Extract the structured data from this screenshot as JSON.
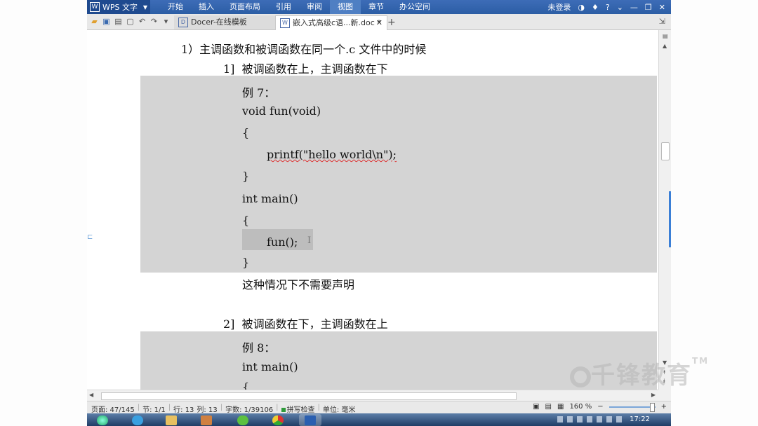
{
  "titlebar": {
    "app_name": "WPS 文字",
    "menu": [
      "开始",
      "插入",
      "页面布局",
      "引用",
      "审阅",
      "视图",
      "章节",
      "办公空间"
    ],
    "active_menu": "视图",
    "login": "未登录",
    "help": "?"
  },
  "tabs": [
    {
      "label": "Docer-在线模板"
    },
    {
      "label": "嵌入式高级c语...新.doc *"
    }
  ],
  "document": {
    "heading1": "1）主调函数和被调函数在同一个.c 文件中的时候",
    "sub1": "1]  被调函数在上，主调函数在下",
    "example7_label": "例 7：",
    "code7": [
      "void fun(void)",
      "{",
      "printf(\"hello world\\n\");",
      "}",
      "int main()",
      "{",
      "fun();",
      "}"
    ],
    "note": "这种情况下不需要声明",
    "sub2": "2]  被调函数在下，主调函数在上",
    "example8_label": "例 8：",
    "code8": [
      "int main()",
      "{"
    ]
  },
  "status": {
    "page": "页面: 47/145",
    "section": "节: 1/1",
    "line": "行: 13",
    "col": "列: 13",
    "words": "字数: 1/39106",
    "spell": "拼写检查",
    "unit": "单位: 毫米",
    "zoom": "160 %"
  },
  "taskbar": {
    "clock": "17:22"
  },
  "watermark": {
    "text": "千锋教育",
    "tm": "TM"
  }
}
